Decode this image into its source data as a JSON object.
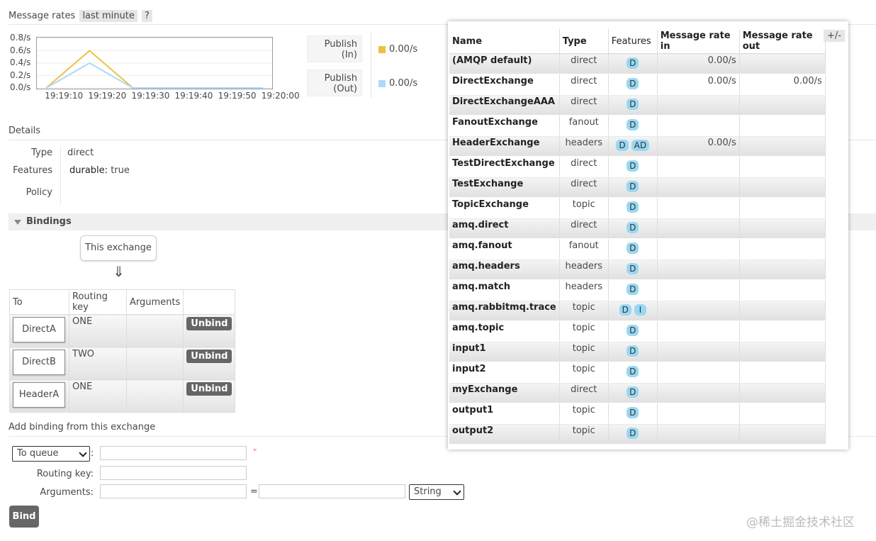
{
  "message_rates": {
    "heading": "Message rates",
    "period": "last minute",
    "help": "?",
    "publish_in_label": "Publish\n(In)",
    "publish_in_value": "0.00/s",
    "publish_out_label": "Publish\n(Out)",
    "publish_out_value": "0.00/s",
    "colors": {
      "in": "#edc240",
      "out": "#afd8f8"
    }
  },
  "chart_data": {
    "type": "line",
    "y_ticks": [
      "0.8/s",
      "0.6/s",
      "0.4/s",
      "0.2/s",
      "0.0/s"
    ],
    "x_ticks": [
      "19:19:10",
      "19:19:20",
      "19:19:30",
      "19:19:40",
      "19:19:50",
      "19:20:00"
    ],
    "ylim": [
      0,
      0.8
    ],
    "series": [
      {
        "name": "Publish (In)",
        "x": [
          "19:19:10",
          "19:19:20",
          "19:19:30",
          "19:20:00"
        ],
        "values": [
          0.0,
          0.6,
          0.0,
          0.0
        ],
        "color": "#edc240"
      },
      {
        "name": "Publish (Out)",
        "x": [
          "19:19:10",
          "19:19:20",
          "19:19:30",
          "19:20:00"
        ],
        "values": [
          0.0,
          0.4,
          0.0,
          0.0
        ],
        "color": "#afd8f8"
      }
    ]
  },
  "details": {
    "heading": "Details",
    "type_label": "Type",
    "type_value": "direct",
    "features_label": "Features",
    "features_key": "durable:",
    "features_value": "true",
    "policy_label": "Policy"
  },
  "bindings": {
    "heading": "Bindings",
    "this_exchange": "This exchange",
    "arrow": "⇓",
    "columns": [
      "To",
      "Routing key",
      "Arguments",
      ""
    ],
    "rows": [
      {
        "to": "DirectA",
        "routing_key": "ONE",
        "unbind": "Unbind"
      },
      {
        "to": "DirectB",
        "routing_key": "TWO",
        "unbind": "Unbind"
      },
      {
        "to": "HeaderA",
        "routing_key": "ONE",
        "unbind": "Unbind"
      }
    ]
  },
  "add_binding": {
    "heading": "Add binding from this exchange",
    "destination_select": "To queue",
    "colon": ":",
    "required_mark": "*",
    "routing_key_label": "Routing key:",
    "arguments_label": "Arguments:",
    "equals": "=",
    "arg_type_select": "String",
    "bind_button": "Bind"
  },
  "exchanges_popup": {
    "columns": [
      "Name",
      "Type",
      "Features",
      "Message rate in",
      "Message rate out"
    ],
    "toggle": "+/-",
    "rows": [
      {
        "name": "(AMQP default)",
        "type": "direct",
        "features": [
          "D"
        ],
        "rate_in": "0.00/s",
        "rate_out": ""
      },
      {
        "name": "DirectExchange",
        "type": "direct",
        "features": [
          "D"
        ],
        "rate_in": "0.00/s",
        "rate_out": "0.00/s"
      },
      {
        "name": "DirectExchangeAAA",
        "type": "direct",
        "features": [
          "D"
        ],
        "rate_in": "",
        "rate_out": ""
      },
      {
        "name": "FanoutExchange",
        "type": "fanout",
        "features": [
          "D"
        ],
        "rate_in": "",
        "rate_out": ""
      },
      {
        "name": "HeaderExchange",
        "type": "headers",
        "features": [
          "D",
          "AD"
        ],
        "rate_in": "0.00/s",
        "rate_out": ""
      },
      {
        "name": "TestDirectExchange",
        "type": "direct",
        "features": [
          "D"
        ],
        "rate_in": "",
        "rate_out": ""
      },
      {
        "name": "TestExchange",
        "type": "direct",
        "features": [
          "D"
        ],
        "rate_in": "",
        "rate_out": ""
      },
      {
        "name": "TopicExchange",
        "type": "topic",
        "features": [
          "D"
        ],
        "rate_in": "",
        "rate_out": ""
      },
      {
        "name": "amq.direct",
        "type": "direct",
        "features": [
          "D"
        ],
        "rate_in": "",
        "rate_out": ""
      },
      {
        "name": "amq.fanout",
        "type": "fanout",
        "features": [
          "D"
        ],
        "rate_in": "",
        "rate_out": ""
      },
      {
        "name": "amq.headers",
        "type": "headers",
        "features": [
          "D"
        ],
        "rate_in": "",
        "rate_out": ""
      },
      {
        "name": "amq.match",
        "type": "headers",
        "features": [
          "D"
        ],
        "rate_in": "",
        "rate_out": ""
      },
      {
        "name": "amq.rabbitmq.trace",
        "type": "topic",
        "features": [
          "D",
          "I"
        ],
        "rate_in": "",
        "rate_out": ""
      },
      {
        "name": "amq.topic",
        "type": "topic",
        "features": [
          "D"
        ],
        "rate_in": "",
        "rate_out": ""
      },
      {
        "name": "input1",
        "type": "topic",
        "features": [
          "D"
        ],
        "rate_in": "",
        "rate_out": ""
      },
      {
        "name": "input2",
        "type": "topic",
        "features": [
          "D"
        ],
        "rate_in": "",
        "rate_out": ""
      },
      {
        "name": "myExchange",
        "type": "direct",
        "features": [
          "D"
        ],
        "rate_in": "",
        "rate_out": ""
      },
      {
        "name": "output1",
        "type": "topic",
        "features": [
          "D"
        ],
        "rate_in": "",
        "rate_out": ""
      },
      {
        "name": "output2",
        "type": "topic",
        "features": [
          "D"
        ],
        "rate_in": "",
        "rate_out": ""
      }
    ]
  },
  "watermark": "@稀土掘金技术社区"
}
